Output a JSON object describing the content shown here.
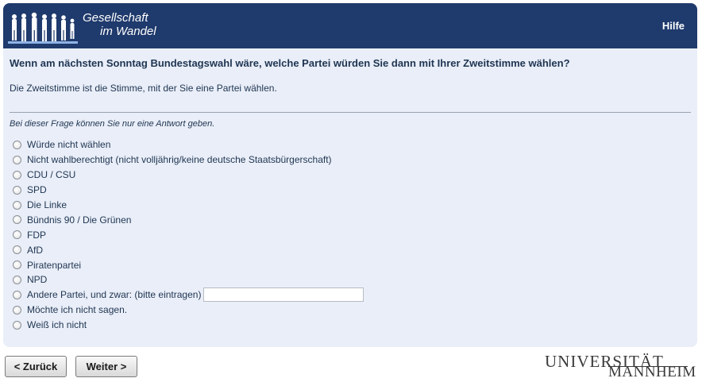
{
  "header": {
    "logo_line1": "Gesellschaft",
    "logo_line2": "im Wandel",
    "help_label": "Hilfe"
  },
  "question": {
    "title": "Wenn am nächsten Sonntag Bundestagswahl wäre, welche Partei würden Sie dann mit Ihrer Zweitstimme wählen?",
    "explanation": "Die Zweitstimme ist die Stimme, mit der Sie eine Partei wählen.",
    "instruction": "Bei dieser Frage können Sie nur eine Antwort geben.",
    "options": [
      "Würde nicht wählen",
      "Nicht wahlberechtigt (nicht volljährig/keine deutsche Staatsbürgerschaft)",
      "CDU / CSU",
      "SPD",
      "Die Linke",
      "Bündnis 90 / Die Grünen",
      "FDP",
      "AfD",
      "Piratenpartei",
      "NPD",
      "Andere Partei, und zwar: (bitte eintragen)",
      "Möchte ich nicht sagen.",
      "Weiß ich nicht"
    ],
    "other_input_value": ""
  },
  "navigation": {
    "back_label": "< Zurück",
    "next_label": "Weiter >"
  },
  "footer_logo": {
    "line1": "UNIVERSITÄT",
    "line2": "MANNHEIM"
  },
  "colors": {
    "header_bg": "#1f3a6c",
    "panel_bg": "#e9eef8",
    "text": "#1f3552"
  }
}
